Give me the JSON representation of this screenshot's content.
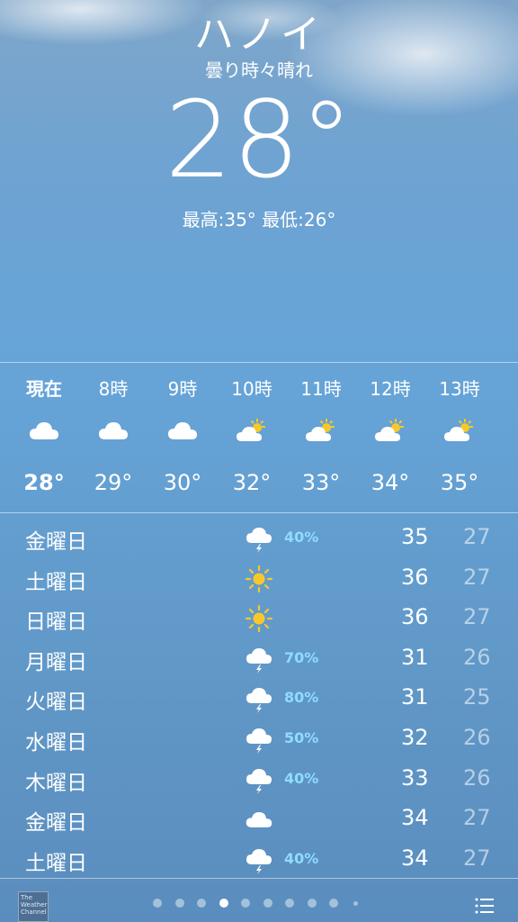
{
  "header": {
    "city": "ハノイ",
    "condition": "曇り時々晴れ",
    "temperature": "28°",
    "high_low": "最高:35° 最低:26°"
  },
  "hourly": [
    {
      "time": "現在",
      "icon": "cloud-icon",
      "temp": "28°"
    },
    {
      "time": "8時",
      "icon": "cloud-icon",
      "temp": "29°"
    },
    {
      "time": "9時",
      "icon": "cloud-icon",
      "temp": "30°"
    },
    {
      "time": "10時",
      "icon": "partly-sunny-icon",
      "temp": "32°"
    },
    {
      "time": "11時",
      "icon": "partly-sunny-icon",
      "temp": "33°"
    },
    {
      "time": "12時",
      "icon": "partly-sunny-icon",
      "temp": "34°"
    },
    {
      "time": "13時",
      "icon": "partly-sunny-icon",
      "temp": "35°"
    }
  ],
  "daily": [
    {
      "day": "金曜日",
      "icon": "thunderstorm-icon",
      "chance": "40%",
      "high": "35",
      "low": "27"
    },
    {
      "day": "土曜日",
      "icon": "sun-icon",
      "chance": "",
      "high": "36",
      "low": "27"
    },
    {
      "day": "日曜日",
      "icon": "sun-icon",
      "chance": "",
      "high": "36",
      "low": "27"
    },
    {
      "day": "月曜日",
      "icon": "thunderstorm-icon",
      "chance": "70%",
      "high": "31",
      "low": "26"
    },
    {
      "day": "火曜日",
      "icon": "thunderstorm-icon",
      "chance": "80%",
      "high": "31",
      "low": "25"
    },
    {
      "day": "水曜日",
      "icon": "thunderstorm-icon",
      "chance": "50%",
      "high": "32",
      "low": "26"
    },
    {
      "day": "木曜日",
      "icon": "thunderstorm-icon",
      "chance": "40%",
      "high": "33",
      "low": "26"
    },
    {
      "day": "金曜日",
      "icon": "cloud-icon",
      "chance": "",
      "high": "34",
      "low": "27"
    },
    {
      "day": "土曜日",
      "icon": "thunderstorm-icon",
      "chance": "40%",
      "high": "34",
      "low": "27"
    }
  ],
  "footer": {
    "provider_logo": "The Weather Channel",
    "page_count": 10,
    "active_page": 4,
    "list_icon": "list-icon"
  },
  "colors": {
    "precip_chance": "#8fdcff",
    "sun": "#f8c82a"
  }
}
